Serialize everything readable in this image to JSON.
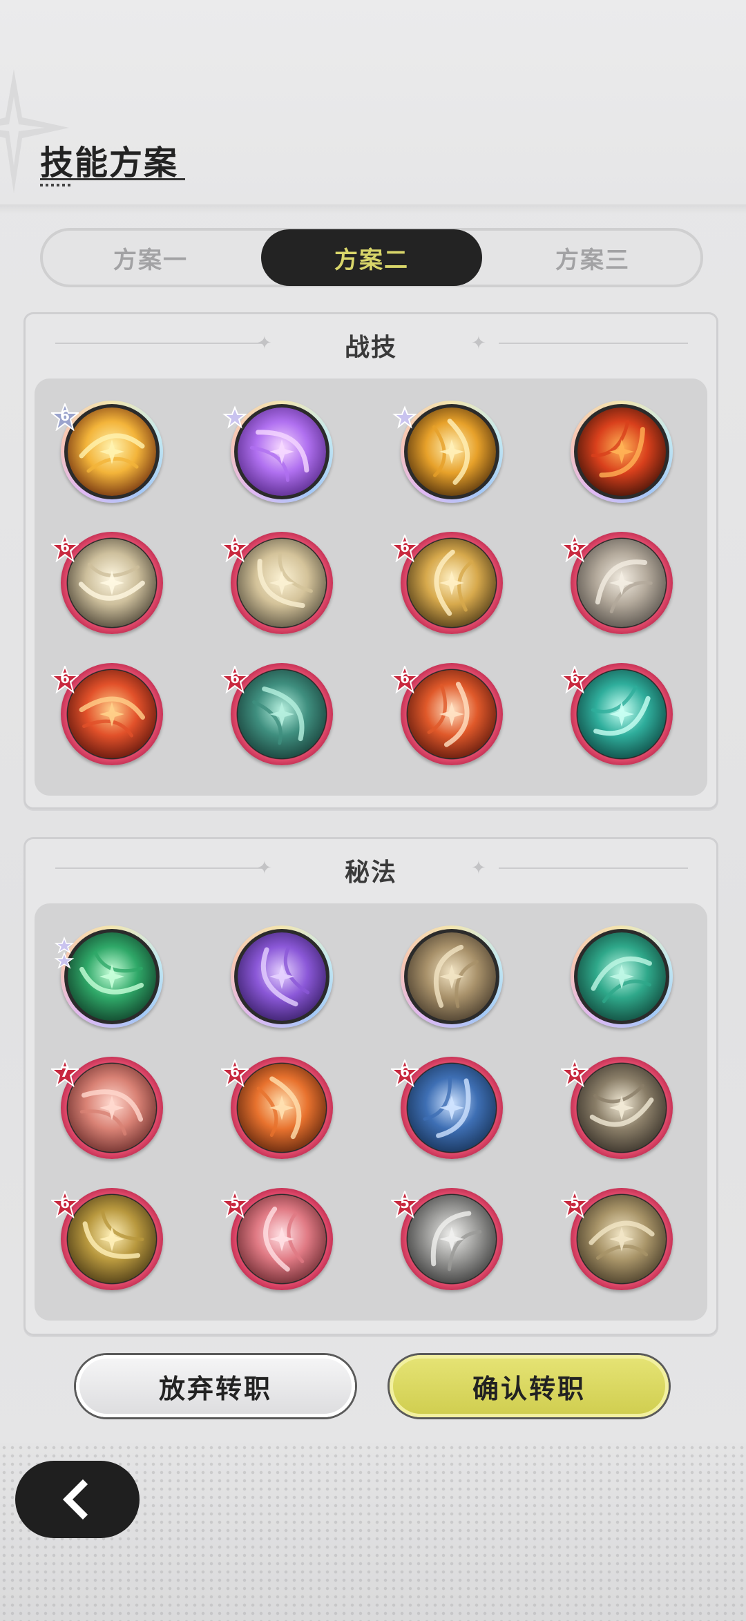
{
  "header": {
    "title": "技能方案"
  },
  "tabs": [
    {
      "label": "方案一",
      "active": false
    },
    {
      "label": "方案二",
      "active": true
    },
    {
      "label": "方案三",
      "active": false
    }
  ],
  "sections": [
    {
      "title": "战技",
      "skills": [
        {
          "icon": "golden-burst-skill-icon",
          "ring": "rainbow",
          "badge": "6",
          "badge_type": "star-blue"
        },
        {
          "icon": "purple-rune-skill-icon",
          "ring": "rainbow",
          "badge": "",
          "badge_type": "star"
        },
        {
          "icon": "crescent-slash-skill-icon",
          "ring": "rainbow",
          "badge": "",
          "badge_type": "star"
        },
        {
          "icon": "fire-swirl-skill-icon",
          "ring": "rainbow",
          "badge": "",
          "badge_type": "none"
        },
        {
          "icon": "arrow-strike-skill-icon",
          "ring": "red",
          "badge": "6",
          "badge_type": "red"
        },
        {
          "icon": "whirlwind-skill-icon",
          "ring": "red",
          "badge": "6",
          "badge_type": "red"
        },
        {
          "icon": "golden-spin-skill-icon",
          "ring": "red",
          "badge": "6",
          "badge_type": "red"
        },
        {
          "icon": "beast-charge-skill-icon",
          "ring": "red",
          "badge": "6",
          "badge_type": "red"
        },
        {
          "icon": "fire-slash-skill-icon",
          "ring": "red",
          "badge": "6",
          "badge_type": "red"
        },
        {
          "icon": "web-skill-icon",
          "ring": "red",
          "badge": "6",
          "badge_type": "red"
        },
        {
          "icon": "flame-body-skill-icon",
          "ring": "red",
          "badge": "6",
          "badge_type": "red"
        },
        {
          "icon": "wind-vortex-skill-icon",
          "ring": "red",
          "badge": "6",
          "badge_type": "red"
        }
      ]
    },
    {
      "title": "秘法",
      "skills": [
        {
          "icon": "green-leaf-skill-icon",
          "ring": "rainbow",
          "badge": "",
          "badge_type": "two-stars"
        },
        {
          "icon": "purple-sword-skill-icon",
          "ring": "rainbow",
          "badge": "",
          "badge_type": "none"
        },
        {
          "icon": "clock-moon-skill-icon",
          "ring": "rainbow",
          "badge": "",
          "badge_type": "none"
        },
        {
          "icon": "jade-crown-skill-icon",
          "ring": "rainbow",
          "badge": "",
          "badge_type": "none"
        },
        {
          "icon": "pink-flower-skill-icon",
          "ring": "red",
          "badge": "7",
          "badge_type": "red"
        },
        {
          "icon": "flame-figure-skill-icon",
          "ring": "red",
          "badge": "6",
          "badge_type": "red"
        },
        {
          "icon": "blue-crystal-skill-icon",
          "ring": "red",
          "badge": "6",
          "badge_type": "red"
        },
        {
          "icon": "bone-claw-skill-icon",
          "ring": "red",
          "badge": "6",
          "badge_type": "red"
        },
        {
          "icon": "golden-shield-skill-icon",
          "ring": "red",
          "badge": "6",
          "badge_type": "red"
        },
        {
          "icon": "pink-sword-skill-icon",
          "ring": "red",
          "badge": "5",
          "badge_type": "red"
        },
        {
          "icon": "silver-guard-skill-icon",
          "ring": "red",
          "badge": "5",
          "badge_type": "red"
        },
        {
          "icon": "sand-fist-skill-icon",
          "ring": "red",
          "badge": "5",
          "badge_type": "red"
        }
      ]
    }
  ],
  "buttons": {
    "cancel": "放弃转职",
    "confirm": "确认转职"
  },
  "back_icon": "chevron-left-icon",
  "colors": {
    "accent": "#d9d66a",
    "ring_red": "#e04a6b",
    "confirm_bg": "#d8d660",
    "dark": "#232323"
  }
}
